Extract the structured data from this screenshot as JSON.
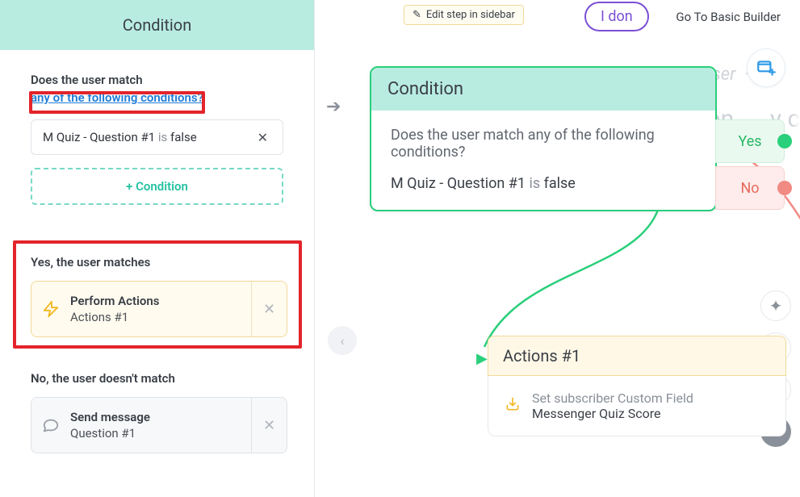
{
  "sidebar": {
    "title": "Condition",
    "match_label": "Does the user match",
    "conditions_link": "any of the following conditions?",
    "rule": {
      "field": "M Quiz - Question #1",
      "is": "is",
      "value": "false"
    },
    "add_condition": "+ Condition",
    "yes_label": "Yes, the user matches",
    "no_label": "No, the user doesn't match",
    "action_card": {
      "title": "Perform Actions",
      "subtitle": "Actions #1"
    },
    "message_card": {
      "title": "Send message",
      "subtitle": "Question #1"
    }
  },
  "topbar": {
    "edit_step": "Edit step in sidebar",
    "pill": "I don",
    "goto": "Go To Basic Builder",
    "ghost_user": "user",
    "ghost_auto": "Auton",
    "ghost_cont": "y continu"
  },
  "condition_node": {
    "title": "Condition",
    "question": "Does the user match any of the following conditions?",
    "rule": {
      "field": "M Quiz - Question #1",
      "is": "is",
      "value": "false"
    },
    "yes": "Yes",
    "no": "No"
  },
  "actions_node": {
    "title": "Actions #1",
    "line1": "Set subscriber Custom Field",
    "line2": "Messenger Quiz Score"
  },
  "glyphs": {
    "close": "✕",
    "plus": "+",
    "minus": "−",
    "magic": "✦",
    "lt": "‹",
    "arrow": "➔",
    "pencil": "✎"
  }
}
